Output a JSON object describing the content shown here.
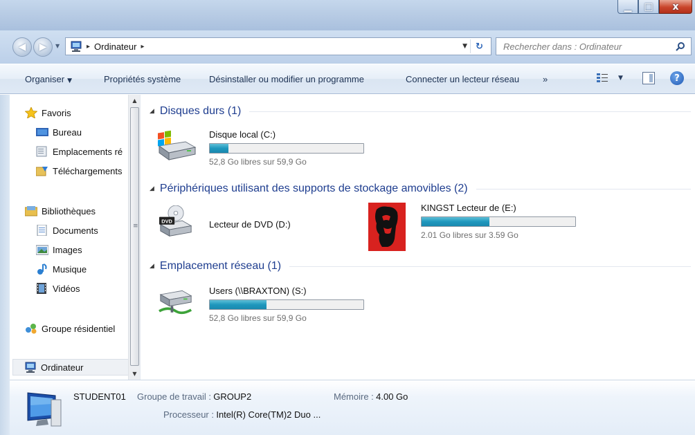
{
  "window": {
    "controls": {
      "minimize": "▁",
      "maximize": "□",
      "close": "x"
    }
  },
  "address": {
    "path_segment": "Ordinateur",
    "separator": "▸",
    "search_placeholder": "Rechercher dans : Ordinateur"
  },
  "commands": {
    "organize": "Organiser",
    "system_properties": "Propriétés système",
    "uninstall": "Désinstaller ou modifier un programme",
    "map_drive": "Connecter un lecteur réseau",
    "more": "»"
  },
  "sidebar": {
    "favorites": {
      "label": "Favoris",
      "items": [
        {
          "label": "Bureau",
          "icon": "desktop-icon"
        },
        {
          "label": "Emplacements ré",
          "icon": "recent-places-icon"
        },
        {
          "label": "Téléchargements",
          "icon": "downloads-icon"
        }
      ]
    },
    "libraries": {
      "label": "Bibliothèques",
      "items": [
        {
          "label": "Documents",
          "icon": "document-icon"
        },
        {
          "label": "Images",
          "icon": "image-icon"
        },
        {
          "label": "Musique",
          "icon": "music-icon"
        },
        {
          "label": "Vidéos",
          "icon": "video-icon"
        }
      ]
    },
    "homegroup": {
      "label": "Groupe résidentiel"
    },
    "computer": {
      "label": "Ordinateur"
    }
  },
  "groups": {
    "hard_drives": {
      "title": "Disques durs (1)",
      "drives": [
        {
          "name": "Disque local (C:)",
          "free_text": "52,8 Go libres sur 59,9 Go",
          "used_fraction": 0.12
        }
      ]
    },
    "removable": {
      "title": "Périphériques utilisant des supports de stockage amovibles (2)",
      "drives": [
        {
          "name": "Lecteur de DVD (D:)",
          "icon_label": "DVD"
        },
        {
          "name": "KINGST Lecteur de (E:)",
          "free_text": "2.01  Go libres sur   3.59 Go",
          "used_fraction": 0.44
        }
      ]
    },
    "network": {
      "title": "Emplacement réseau (1)",
      "drives": [
        {
          "name": "Users (\\\\BRAXTON) (S:)",
          "free_text": "52,8 Go libres sur 59,9 Go",
          "used_fraction": 0.37
        }
      ]
    }
  },
  "details": {
    "computer_name": "STUDENT01",
    "workgroup_label": "Groupe de travail :",
    "workgroup_value": "GROUP2",
    "memory_label": "Mémoire :",
    "memory_value": "4.00 Go",
    "processor_label": "Processeur :",
    "processor_value": "Intel(R) Core(TM)2 Duo ..."
  },
  "colors": {
    "accent_header": "#1e3d8f",
    "bar_fill": "#1f97bd",
    "close_button": "#c9452b"
  }
}
